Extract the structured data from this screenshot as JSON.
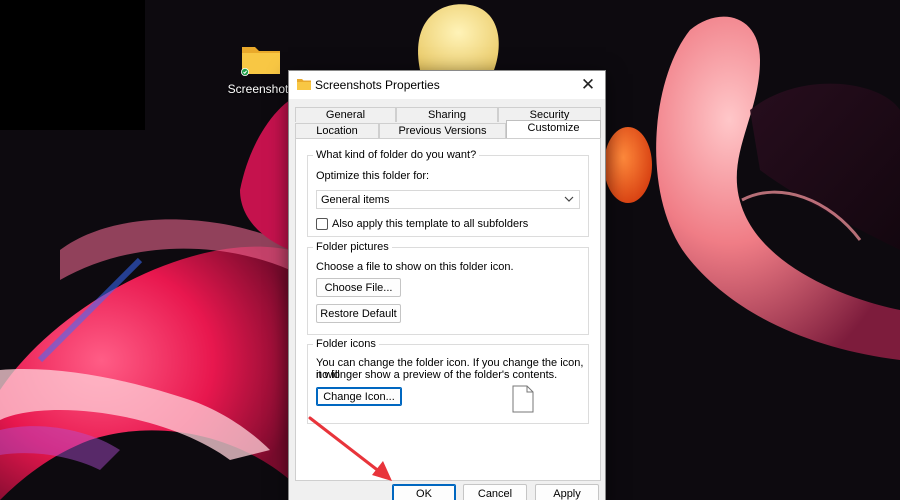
{
  "desktop": {
    "folder_label": "Screenshots",
    "folder_icon": "folder-icon",
    "sync_badge_icon": "check-badge-icon"
  },
  "dialog": {
    "title": "Screenshots Properties",
    "close_glyph": "✕",
    "tabs_row1": [
      {
        "label": "General"
      },
      {
        "label": "Sharing"
      },
      {
        "label": "Security"
      }
    ],
    "tabs_row2": [
      {
        "label": "Location"
      },
      {
        "label": "Previous Versions"
      },
      {
        "label": "Customize",
        "active": true
      }
    ],
    "folder_type": {
      "title": "What kind of folder do you want?",
      "optimize_label": "Optimize this folder for:",
      "selected_option": "General items",
      "apply_subfolders_label": "Also apply this template to all subfolders",
      "apply_subfolders_checked": false
    },
    "folder_pictures": {
      "title": "Folder pictures",
      "description": "Choose a file to show on this folder icon.",
      "choose_file_label": "Choose File...",
      "restore_default_label": "Restore Default"
    },
    "folder_icons": {
      "title": "Folder icons",
      "description_line1": "You can change the folder icon. If you change the icon, it will",
      "description_line2": "no longer show a preview of the folder's contents.",
      "change_icon_label": "Change Icon..."
    },
    "footer": {
      "ok_label": "OK",
      "cancel_label": "Cancel",
      "apply_label": "Apply"
    }
  },
  "colors": {
    "accent": "#0067c0",
    "annotation_arrow": "#e8343b",
    "folder_yellow": "#f8c744"
  }
}
